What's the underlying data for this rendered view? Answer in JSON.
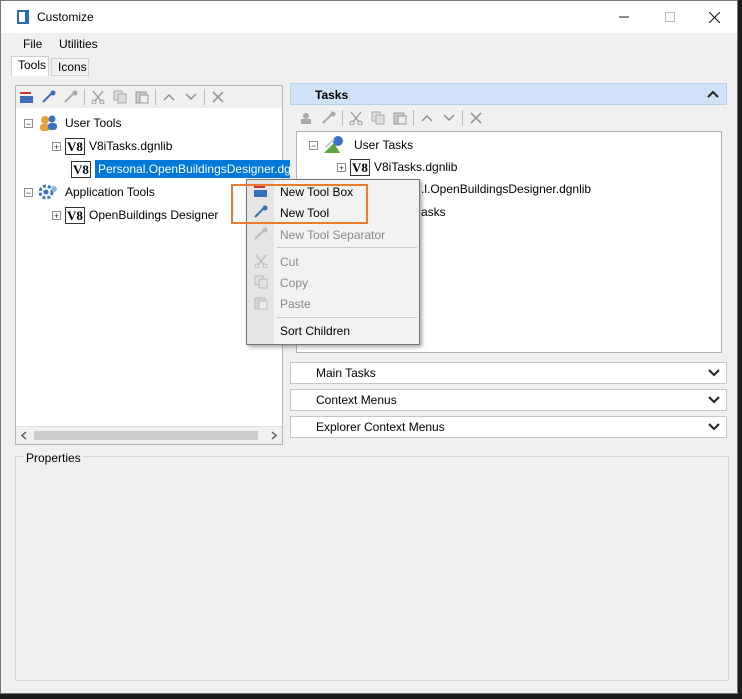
{
  "window": {
    "title": "Customize"
  },
  "menubar": {
    "items": [
      "File",
      "Utilities"
    ]
  },
  "tabs": [
    "Tools",
    "Icons"
  ],
  "tools_tree": {
    "root_user": "User Tools",
    "user_children": [
      "V8iTasks.dgnlib",
      "Personal.OpenBuildingsDesigner.dgnlib"
    ],
    "root_app": "Application Tools",
    "app_children": [
      "OpenBuildings Designer"
    ],
    "v8_label": "V8"
  },
  "tasks_panel": {
    "header": "Tasks",
    "root": "User Tasks",
    "children": [
      "V8iTasks.dgnlib",
      ".l.OpenBuildingsDesigner.dgnlib",
      "asks"
    ]
  },
  "sections": [
    "Main Tasks",
    "Context Menus",
    "Explorer Context Menus"
  ],
  "properties": {
    "label": "Properties"
  },
  "context_menu": {
    "items": [
      "New Tool Box",
      "New Tool",
      "New Tool Separator",
      "Cut",
      "Copy",
      "Paste",
      "Sort Children"
    ]
  },
  "colors": {
    "selection": "#0078d7",
    "highlight": "#e87d2f",
    "section_header": "#cfe2f8"
  }
}
